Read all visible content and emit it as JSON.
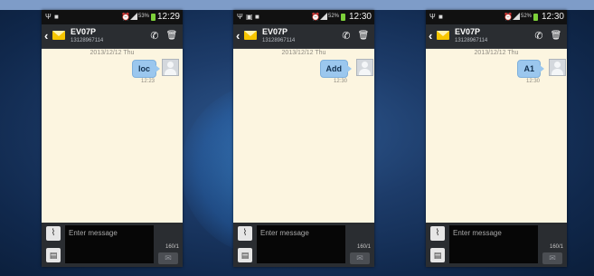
{
  "phones": [
    {
      "status": {
        "time": "12:29",
        "battery": "53%"
      },
      "header": {
        "name": "EV07P",
        "number": "13128967114"
      },
      "conversation": {
        "date": "2013/12/12 Thu",
        "message": "loc",
        "time": "12:23"
      },
      "composer": {
        "placeholder": "Enter message",
        "counter": "160/1"
      }
    },
    {
      "status": {
        "time": "12:30",
        "battery": "52%"
      },
      "header": {
        "name": "EV07P",
        "number": "13128967114"
      },
      "conversation": {
        "date": "2013/12/12 Thu",
        "message": "Add",
        "time": "12:30"
      },
      "composer": {
        "placeholder": "Enter message",
        "counter": "160/1"
      }
    },
    {
      "status": {
        "time": "12:30",
        "battery": "52%"
      },
      "header": {
        "name": "EV07P",
        "number": "13128967114"
      },
      "conversation": {
        "date": "2013/12/12 Thu",
        "message": "A1",
        "time": "12:30"
      },
      "composer": {
        "placeholder": "Enter message",
        "counter": "160/1"
      }
    }
  ],
  "icons": {
    "back": "chevron-left-icon",
    "contact": "envelope-icon",
    "call": "phone-icon",
    "delete": "trash-icon",
    "attach": "paperclip-icon",
    "template": "note-icon",
    "send": "envelope-send-icon",
    "avatar": "person-icon"
  },
  "colors": {
    "background": "#1d3c6a",
    "conversation": "#fcf5e0",
    "bubble": "#9bc7ee",
    "actionbar": "#2a2d31",
    "accent_band": "#7e9cc8"
  }
}
